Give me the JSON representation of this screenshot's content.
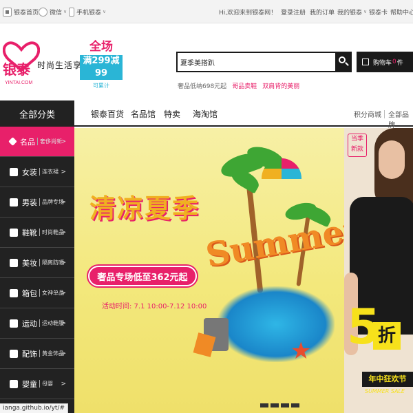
{
  "topbar": {
    "left": [
      {
        "icon": "home-icon",
        "label": "银泰首页"
      },
      {
        "icon": "wechat-icon",
        "label": "微信"
      },
      {
        "icon": "mobile-icon",
        "label": "手机银泰"
      }
    ],
    "greeting": "Hi,欢迎来到银泰网！",
    "login": "登录",
    "register": "注册",
    "my_orders": "我的订单",
    "my_yintai": "我的银泰",
    "yintai_card": "银泰卡",
    "help": "帮助中心"
  },
  "header": {
    "logo_cn": "银泰",
    "logo_en": "YINTAI.COM",
    "slogan": "时尚生活享受",
    "promo_big": "全场",
    "promo_mid": "满299减99",
    "promo_small": "可累计",
    "search_value": "夏季美搭趴",
    "hot_words": [
      "奢品低纳698元起",
      "哥品卖鞋",
      "双肩背的美丽"
    ],
    "cart_label": "购物车",
    "cart_count": "0",
    "cart_unit": "件"
  },
  "nav": {
    "all_categories": "全部分类",
    "items": [
      "银泰百货",
      "名品馆",
      "特卖",
      "海淘馆"
    ],
    "right": [
      "积分商城",
      "全部品牌"
    ]
  },
  "categories": [
    {
      "icon": "diamond-icon",
      "name": "名品",
      "sub": "奢侈尚新",
      "active": true
    },
    {
      "icon": "dress-icon",
      "name": "女装",
      "sub": "连衣裙",
      "active": false
    },
    {
      "icon": "shirt-icon",
      "name": "男装",
      "sub": "品牌专场",
      "active": false
    },
    {
      "icon": "shoe-icon",
      "name": "鞋靴",
      "sub": "时尚鞋品",
      "active": false
    },
    {
      "icon": "cosmetic-icon",
      "name": "美妆",
      "sub": "隔离防晒",
      "active": false
    },
    {
      "icon": "bag-icon",
      "name": "箱包",
      "sub": "女神单品",
      "active": false
    },
    {
      "icon": "sport-icon",
      "name": "运动",
      "sub": "运动鞋服",
      "active": false
    },
    {
      "icon": "jewelry-icon",
      "name": "配饰",
      "sub": "黄金饰品",
      "active": false
    },
    {
      "icon": "baby-icon",
      "name": "婴童",
      "sub": "母婴",
      "active": false
    }
  ],
  "banner": {
    "title": "清凉夏季",
    "promo": "奢品专场低至362元起",
    "date": "活动时间: 7.1 10:00-7.12 10:00",
    "art_text": "Summer"
  },
  "side_ad": {
    "badge": "当季新款",
    "five": "5",
    "discount": "折",
    "festival": "年中狂欢节",
    "sub": "SUMMER SALE"
  },
  "status_url": "ianga.github.io/yt/#",
  "colors": {
    "accent": "#e8206a",
    "dark": "#222222",
    "cyan": "#2ab5d6",
    "gold": "#f0b021"
  }
}
